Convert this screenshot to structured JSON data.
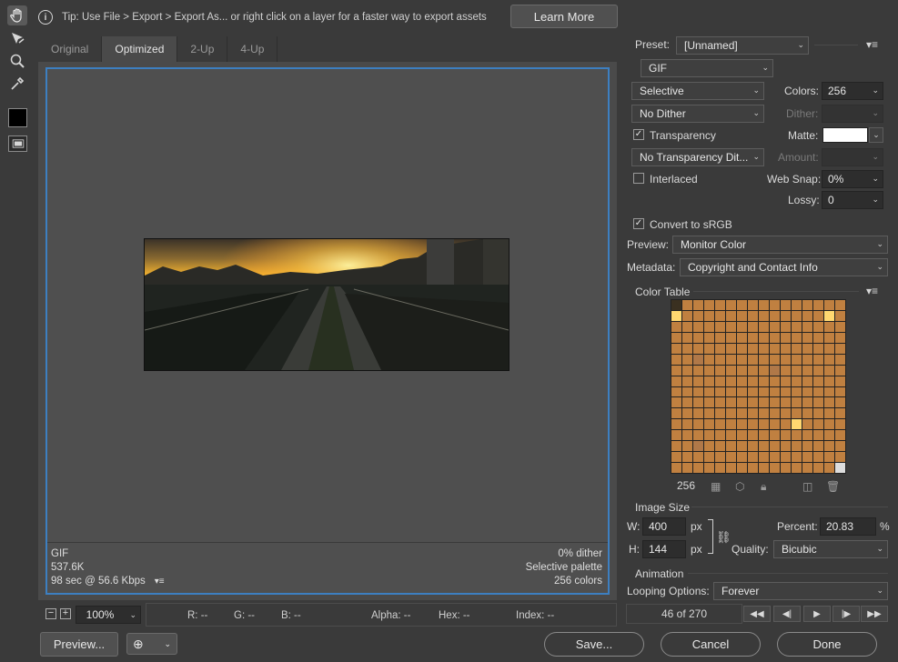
{
  "tip": {
    "text": "Tip: Use File > Export > Export As...  or right click on a layer for a faster way to export assets",
    "learn_more": "Learn More"
  },
  "tabs": [
    "Original",
    "Optimized",
    "2-Up",
    "4-Up"
  ],
  "active_tab": "Optimized",
  "preview_info": {
    "format": "GIF",
    "size": "537.6K",
    "time": "98 sec @ 56.6 Kbps",
    "dither": "0% dither",
    "palette": "Selective palette",
    "colors": "256 colors"
  },
  "zoom": "100%",
  "readouts": {
    "r": "R: --",
    "g": "G: --",
    "b": "B: --",
    "alpha": "Alpha: --",
    "hex": "Hex: --",
    "index": "Index: --"
  },
  "buttons": {
    "preview": "Preview...",
    "save": "Save...",
    "cancel": "Cancel",
    "done": "Done"
  },
  "settings": {
    "preset_label": "Preset:",
    "preset_value": "[Unnamed]",
    "format": "GIF",
    "reduction": "Selective",
    "colors_label": "Colors:",
    "colors_value": "256",
    "dither_algo": "No Dither",
    "dither_label": "Dither:",
    "transparency_label": "Transparency",
    "transparency_checked": true,
    "matte_label": "Matte:",
    "trans_dither": "No Transparency Dit...",
    "amount_label": "Amount:",
    "interlaced_label": "Interlaced",
    "interlaced_checked": false,
    "websnap_label": "Web Snap:",
    "websnap_value": "0%",
    "lossy_label": "Lossy:",
    "lossy_value": "0",
    "srgb_label": "Convert to sRGB",
    "srgb_checked": true,
    "preview_label": "Preview:",
    "preview_value": "Monitor Color",
    "metadata_label": "Metadata:",
    "metadata_value": "Copyright and Contact Info"
  },
  "color_table": {
    "title": "Color Table",
    "count": "256"
  },
  "image_size": {
    "title": "Image Size",
    "w_label": "W:",
    "w_value": "400",
    "h_label": "H:",
    "h_value": "144",
    "unit": "px",
    "percent_label": "Percent:",
    "percent_value": "20.83",
    "percent_unit": "%",
    "quality_label": "Quality:",
    "quality_value": "Bicubic"
  },
  "animation": {
    "title": "Animation",
    "looping_label": "Looping Options:",
    "looping_value": "Forever",
    "frame": "46 of 270"
  },
  "colors": {
    "accent": "#3d7fc1",
    "background": "#3a3a3a",
    "matte": "#ffffff"
  }
}
